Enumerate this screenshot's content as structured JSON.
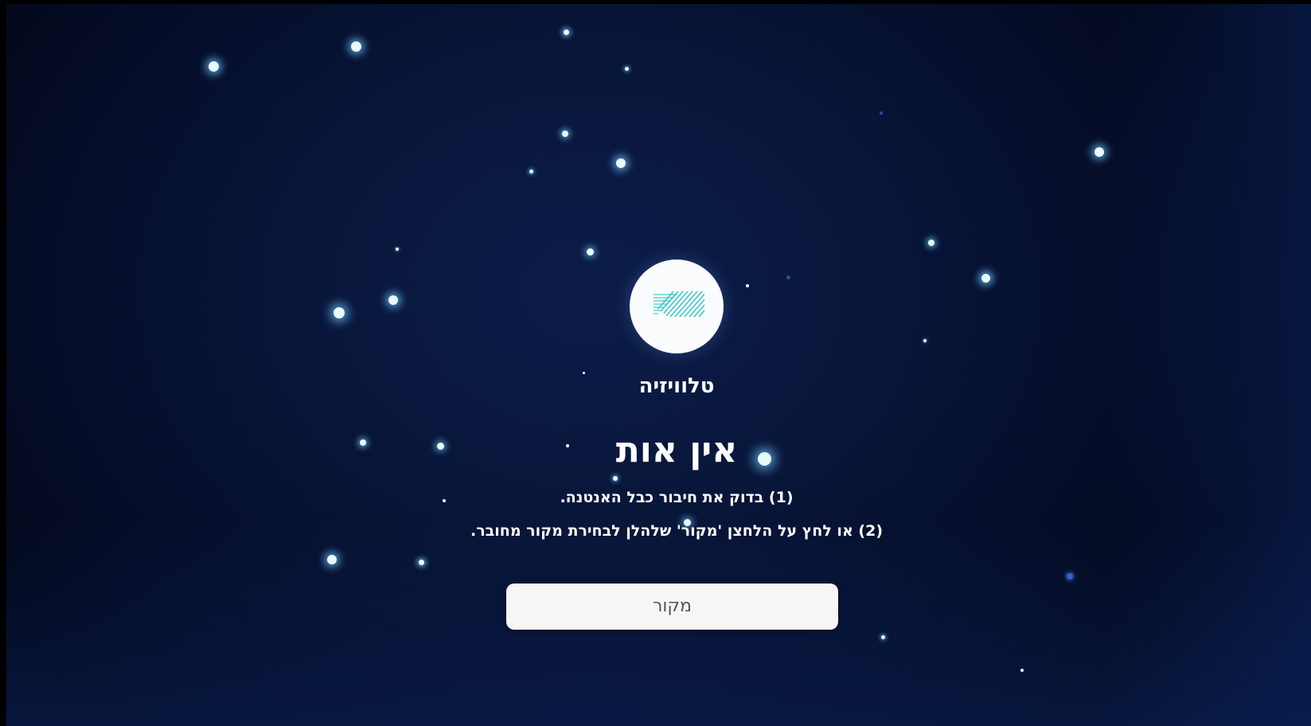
{
  "source": {
    "name": "טלוויזיה",
    "icon": "tv-antenna-icon"
  },
  "message": {
    "title": "אין אות",
    "instruction_1": "(1) בדוק את חיבור כבל האנטנה.",
    "instruction_2": "(2) או לחץ על הלחצן 'מקור' שלהלן לבחירת מקור מחובר."
  },
  "actions": {
    "source_button_label": "מקור"
  },
  "colors": {
    "background": "#081538",
    "text": "#ffffff",
    "button_background": "#f6f6f6",
    "button_text": "#555555",
    "icon_accent": "#3ec6c9"
  }
}
